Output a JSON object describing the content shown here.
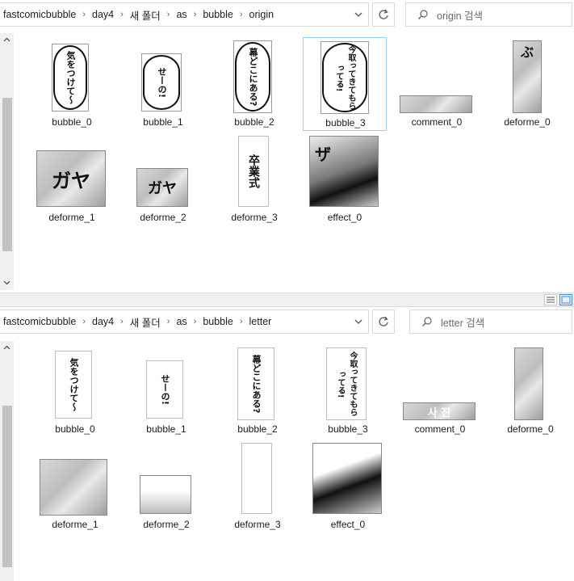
{
  "top": {
    "breadcrumb": [
      "fastcomicbubble",
      "day4",
      "새 폴더",
      "as",
      "bubble",
      "origin"
    ],
    "search_placeholder": "origin 검색",
    "items": [
      {
        "label": "bubble_0",
        "text": "気をつけて〜"
      },
      {
        "label": "bubble_1",
        "text": "せーの!"
      },
      {
        "label": "bubble_2",
        "text": "幕どこにある?"
      },
      {
        "label": "bubble_3",
        "text": "今取ってきてもらってる!"
      },
      {
        "label": "comment_0",
        "text": ""
      },
      {
        "label": "deforme_0",
        "text": "ぶ"
      },
      {
        "label": "deforme_1",
        "text": "ガヤ"
      },
      {
        "label": "deforme_2",
        "text": "ガヤ"
      },
      {
        "label": "deforme_3",
        "text": "卒業式"
      },
      {
        "label": "effect_0",
        "text": "ザ"
      }
    ]
  },
  "bottom": {
    "breadcrumb": [
      "fastcomicbubble",
      "day4",
      "새 폴더",
      "as",
      "bubble",
      "letter"
    ],
    "search_placeholder": "letter 검색",
    "items": [
      {
        "label": "bubble_0",
        "text": "気をつけて〜"
      },
      {
        "label": "bubble_1",
        "text": "せーの!"
      },
      {
        "label": "bubble_2",
        "text": "幕どこにある?"
      },
      {
        "label": "bubble_3",
        "text": "今取ってきてもらってる!"
      },
      {
        "label": "comment_0",
        "text": "사 진"
      },
      {
        "label": "deforme_0",
        "text": ""
      },
      {
        "label": "deforme_1",
        "text": ""
      },
      {
        "label": "deforme_2",
        "text": ""
      },
      {
        "label": "deforme_3",
        "text": ""
      },
      {
        "label": "effect_0",
        "text": ""
      }
    ]
  },
  "colors": {
    "selection_border": "#99d1ff",
    "accent": "#3c8fd8"
  },
  "icons": [
    "chevron-right-icon",
    "chevron-down-icon",
    "refresh-icon",
    "search-icon",
    "details-view-icon",
    "large-icons-view-icon"
  ]
}
